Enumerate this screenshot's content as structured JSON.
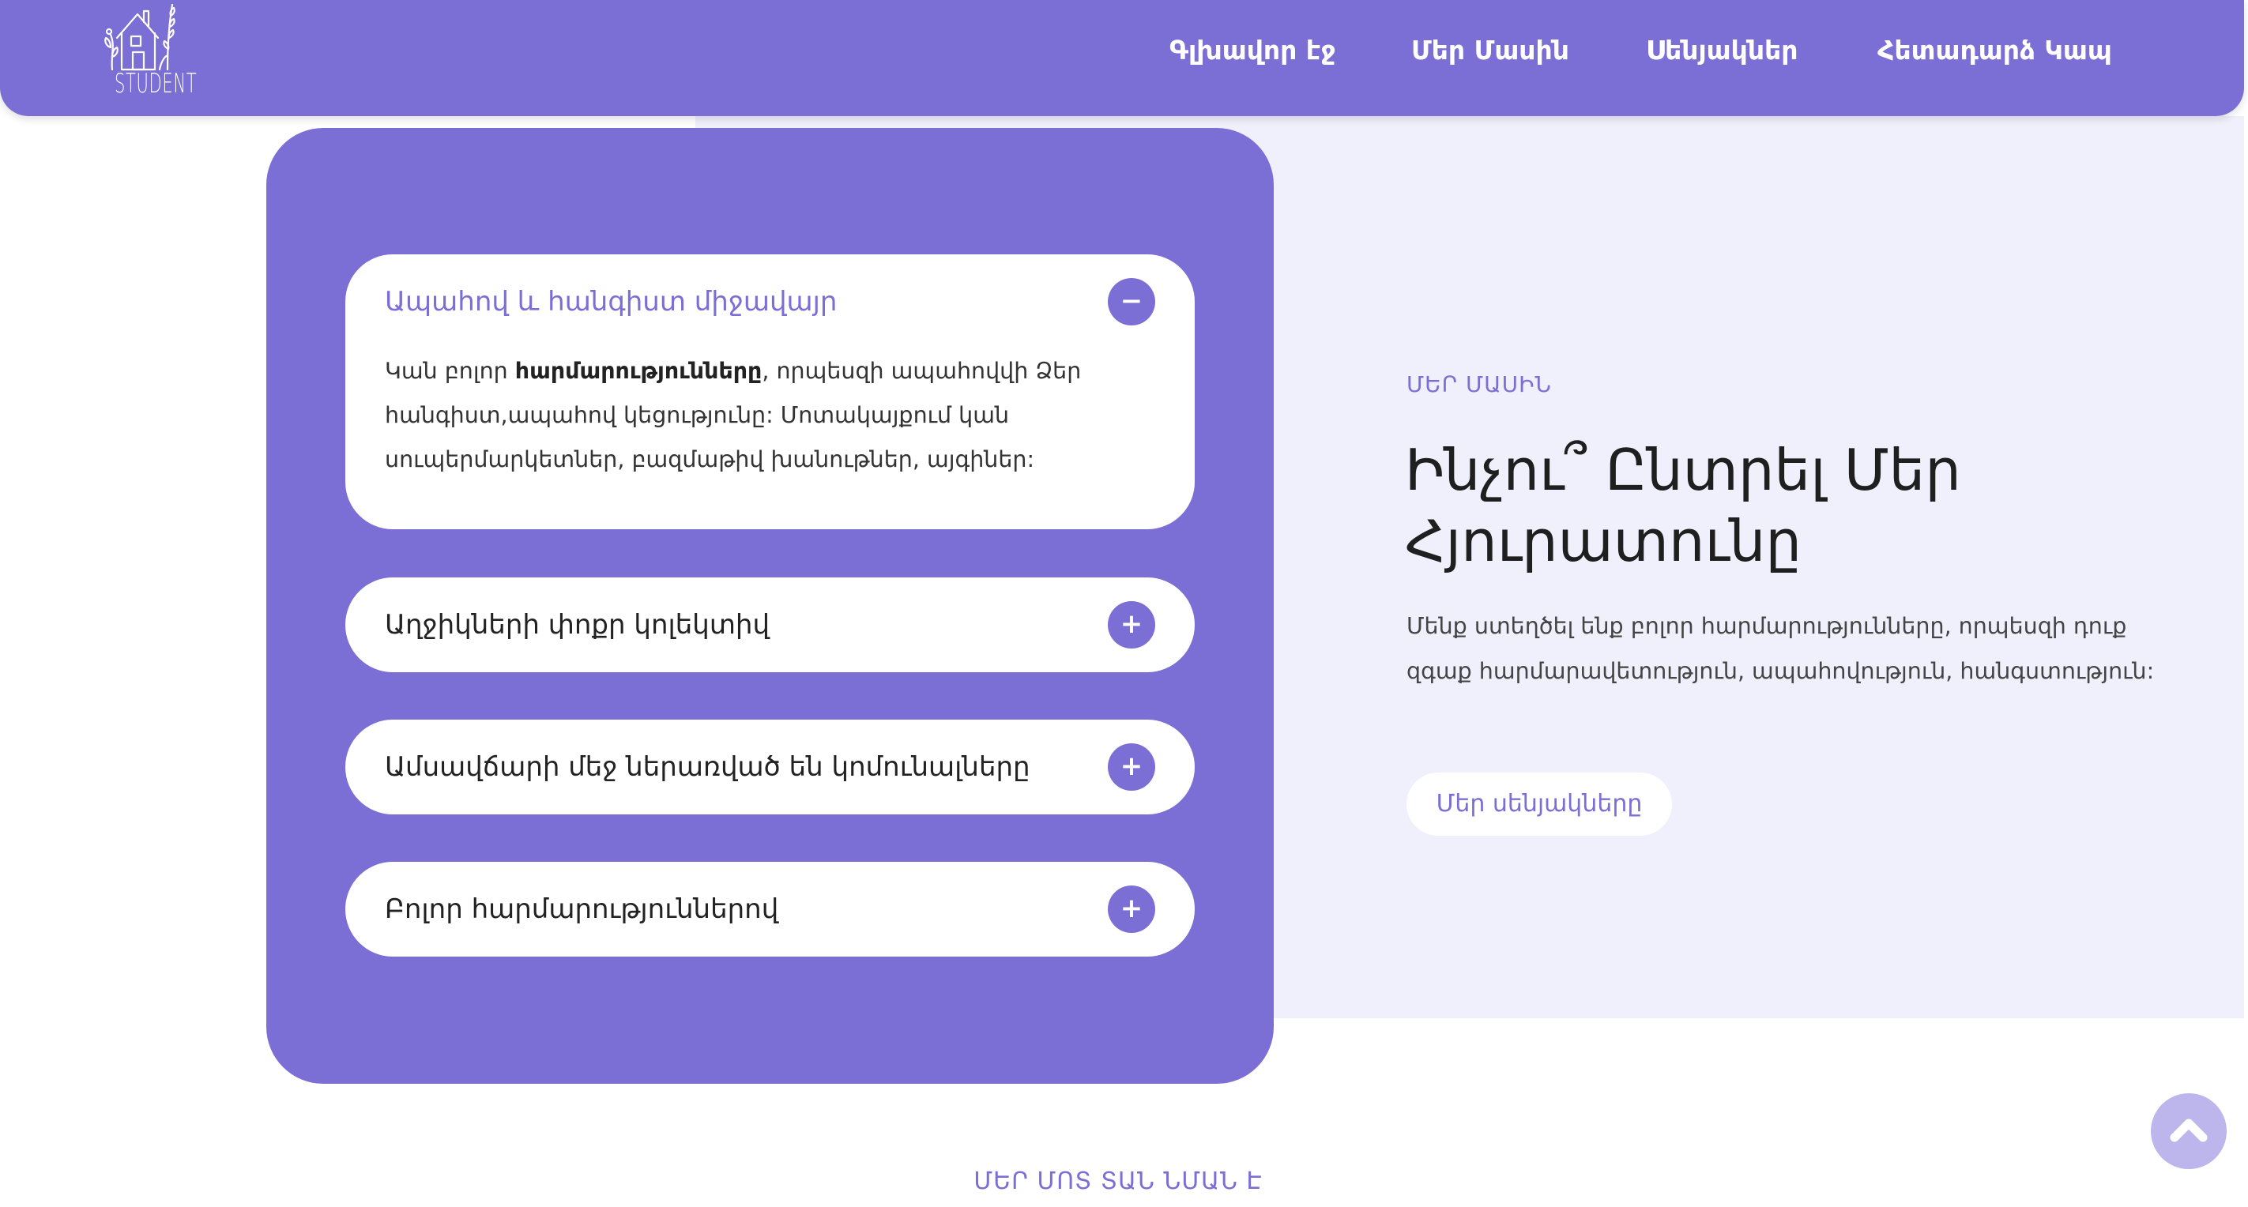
{
  "header": {
    "logo_text": "STUDENT",
    "nav": [
      {
        "label": "Գլխավոր էջ"
      },
      {
        "label": "Մեր Մասին"
      },
      {
        "label": "Սենյակներ"
      },
      {
        "label": "Հետադարձ Կապ"
      }
    ]
  },
  "faq": {
    "items": [
      {
        "title": "Ապահով և հանգիստ միջավայր",
        "toggle": "−",
        "body_start": "Կան բոլոր ",
        "body_bold": "հարմարությունները",
        "body_end": ", որպեսզի ապահովվի Ձեր հանգիստ,ապահով կեցությունը: Մոտակայքում կան սուպերմարկետներ, բազմաթիվ խանութներ, այգիներ:"
      },
      {
        "title": "Աղջիկների փոքր կոլեկտիվ",
        "toggle": "+"
      },
      {
        "title": "Ամսավճարի մեջ ներառված են կոմունալները",
        "toggle": "+"
      },
      {
        "title": "Բոլոր հարմարություններով",
        "toggle": "+"
      }
    ]
  },
  "about": {
    "label": "ՄԵՐ ՄԱՍԻՆ",
    "title": "Ինչու՞ Ընտրել Մեր Հյուրատունը",
    "text": "Մենք ստեղծել ենք բոլոր հարմարությունները, որպեսզի դուք զգաք հարմարավետություն, ապահովություն, հանգստություն:",
    "button_label": "Մեր սենյակները"
  },
  "bottom": {
    "label": "ՄԵՐ ՄՈՏ ՏԱՆ ՆՄԱՆ Է"
  },
  "colors": {
    "brand": "#7b6fd6",
    "panel": "#f0effc",
    "scroll_button": "#bdb6ec"
  },
  "icons": {
    "logo": "house-with-plants-logo",
    "scroll_top": "chevron-up-icon"
  }
}
